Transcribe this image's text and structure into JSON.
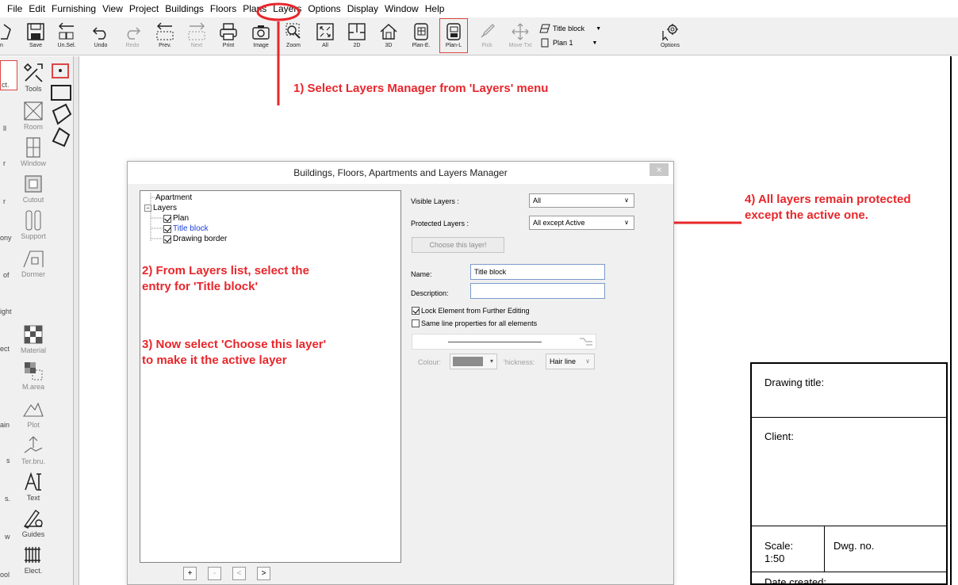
{
  "menu": [
    "File",
    "Edit",
    "Furnishing",
    "View",
    "Project",
    "Buildings",
    "Floors",
    "Plans",
    "Layers",
    "Options",
    "Display",
    "Window",
    "Help"
  ],
  "toolbar": {
    "buttons": [
      "n",
      "Save",
      "Un.Sel.",
      "Undo",
      "Redo",
      "Prev.",
      "Next",
      "Print",
      "Image",
      "Zoom",
      "All",
      "2D",
      "3D",
      "Plan-E.",
      "Plan-L",
      "Pick",
      "Move Txt",
      "Options"
    ],
    "layer_combo": "Title block",
    "plan_combo": "Plan 1"
  },
  "palette": {
    "left_labels": [
      "ct.",
      "ll",
      "r",
      "r",
      "ony",
      "of",
      "ight",
      "ect",
      "ain",
      "s",
      "s.",
      "w",
      "ool"
    ],
    "tools": [
      "Tools",
      "Room",
      "Window",
      "Cutout",
      "Support",
      "Dormer",
      "Material",
      "M.area",
      "Plot",
      "Ter.bru.",
      "Text",
      "Guides",
      "Elect."
    ]
  },
  "annotations": {
    "step1": "1) Select Layers Manager from 'Layers' menu",
    "step2_line1": "2) From Layers list, select the",
    "step2_line2": "entry for 'Title block'",
    "step3_line1": "3) Now select 'Choose this layer'",
    "step3_line2": "to make it the active layer",
    "step4_line1": "4) All layers remain protected",
    "step4_line2": "except the active one."
  },
  "dialog": {
    "title": "Buildings, Floors, Apartments and Layers Manager",
    "close": "×",
    "tree": {
      "apartment": "Apartment",
      "layers": "Layers",
      "items": [
        "Plan",
        "Title block",
        "Drawing border"
      ]
    },
    "nav": [
      "+",
      "-",
      "<",
      ">"
    ],
    "visible_layers_label": "Visible Layers :",
    "visible_layers_value": "All",
    "protected_layers_label": "Protected Layers :",
    "protected_layers_value": "All except Active",
    "choose_button": "Choose this layer!",
    "name_label": "Name:",
    "name_value": "Title block",
    "description_label": "Description:",
    "description_value": "",
    "lock_label": "Lock Element from Further Editing",
    "same_line_label": "Same line properties for all elements",
    "colour_label": "Colour:",
    "thickness_label": "'hickness:",
    "thickness_value": "Hair line"
  },
  "title_block": {
    "drawing_title": "Drawing title:",
    "client": "Client:",
    "scale": "Scale:",
    "scale_value": "1:50",
    "dwg_no": "Dwg. no.",
    "date_created": "Date created:"
  },
  "colors": {
    "annotation": "#e8262b",
    "selection_text": "#1a3fd9"
  }
}
